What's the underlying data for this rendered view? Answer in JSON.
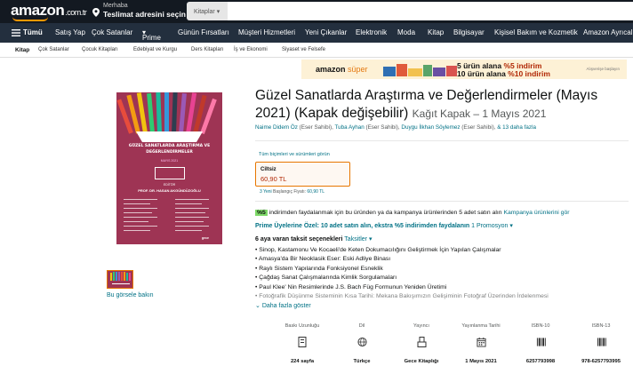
{
  "header": {
    "logo": "amazon",
    "logo_tld": ".com.tr",
    "location_line1": "Merhaba",
    "location_line2": "Teslimat adresini seçin",
    "search_category": "Kitaplar",
    "colors": {
      "topbar": "#131921",
      "navbar": "#232f3e",
      "accent": "#ff9900"
    }
  },
  "main_nav": {
    "all_label": "Tümü",
    "items": [
      "Satış Yap",
      "Çok Satanlar",
      "Prime",
      "Günün Fırsatları",
      "Müşteri Hizmetleri",
      "Yeni Çıkanlar",
      "Elektronik",
      "Moda",
      "Kitap",
      "Bilgisayar",
      "Kişisel Bakım ve Kozmetik",
      "Amazon Ayrıcalı"
    ]
  },
  "sub_nav": {
    "items": [
      "Kitap",
      "Çok Satanlar",
      "Çocuk Kitapları",
      "Edebiyat ve Kurgu",
      "Ders Kitapları",
      "İş ve Ekonomi",
      "Siyaset ve Felsefe"
    ]
  },
  "promo_banner": {
    "brand": "amazon",
    "brand_suffix": "süper",
    "line1_prefix": "5 ürün alana ",
    "line1_offer": "%5 indirim",
    "line2_prefix": "10 ürün alana ",
    "line2_offer": "%10 indirim",
    "ad_label": "Alışverişe başlayın"
  },
  "cover": {
    "title_line1": "GÜZEL SANATLARDA ARAŞTIRMA VE",
    "title_line2": "DEĞERLENDİRMELER",
    "date": "MAYIS 2021",
    "editor_label": "EDİTÖR",
    "editor_name": "PROF. DR. HASAN AKGÜNDÜZOĞLU",
    "publisher": "gece"
  },
  "gallery": {
    "link_text": "Bu görsele bakın"
  },
  "product": {
    "title": "Güzel Sanatlarda Araştırma ve Değerlendirmeler (Mayıs 2021) (Kapak değişebilir)",
    "subtitle": "Kağıt Kapak – 1 Mayıs 2021",
    "authors": [
      {
        "name": "Naime Didem Öz",
        "role": " (Eser Sahibi), "
      },
      {
        "name": "Tuba Ayhan",
        "role": " (Eser Sahibi), "
      },
      {
        "name": "Duygu İlkhan Söylemez",
        "role": " (Eser Sahibi), "
      }
    ],
    "more_authors": "& 13 daha fazla",
    "all_formats": "Tüm biçimleri ve sürümleri görün",
    "format_name": "Ciltsiz",
    "format_price": "60,90 TL",
    "new_from_link": "3 Yeni",
    "new_from_text": " Başlangıç Fiyatı: ",
    "new_from_price": "60,90 TL"
  },
  "offers": {
    "badge": "%5",
    "deal_text": " indirimden faydalanmak için bu üründen ya da kampanya ürünlerinden 5 adet satın alın ",
    "deal_link": "Kampanya ürünlerini gör",
    "prime_text": "Prime Üyelerine Özel: 10 adet satın alın, ekstra %5 indirimden faydalanın",
    "promotions": "1 Promosyon",
    "installment_bold": "6 aya varan taksit seçenekleri",
    "installment_link": "Taksitler"
  },
  "bullets": [
    "• Sinop, Kastamonu Ve Kocaeli'de Keten Dokumacılığını Geliştirmek İçin Yapılan Çalışmalar",
    "• Amasya'da Bir Neoklasik Eser: Eski Adliye Binası",
    "• Raylı Sistem Yapılarında Fonksiyonel Esneklik",
    "• Çağdaş Sanat Çalışmalarında Kimlik Sorgulamaları",
    "• Paul Klee' Nin Resimlerinde J.S. Bach Füg Formunun Yeniden Üretimi",
    "• Fotoğrafik Düşünme Sisteminin Kısa Tarihi: Mekana Bakışımızın Gelişiminin Fotoğraf Üzerinden İrdelenmesi"
  ],
  "show_more": "Daha fazla göster",
  "details": [
    {
      "header": "Baskı Uzunluğu",
      "value": "224 sayfa",
      "icon": "pages-icon"
    },
    {
      "header": "Dil",
      "value": "Türkçe",
      "icon": "globe-icon"
    },
    {
      "header": "Yayıncı",
      "value": "Gece Kitaplığı",
      "icon": "publisher-icon"
    },
    {
      "header": "Yayınlanma Tarihi",
      "value": "1 Mayıs 2021",
      "icon": "calendar-icon"
    },
    {
      "header": "ISBN-10",
      "value": "6257793998",
      "icon": "barcode-icon"
    },
    {
      "header": "ISBN-13",
      "value": "978-6257793995",
      "icon": "barcode-icon"
    }
  ]
}
